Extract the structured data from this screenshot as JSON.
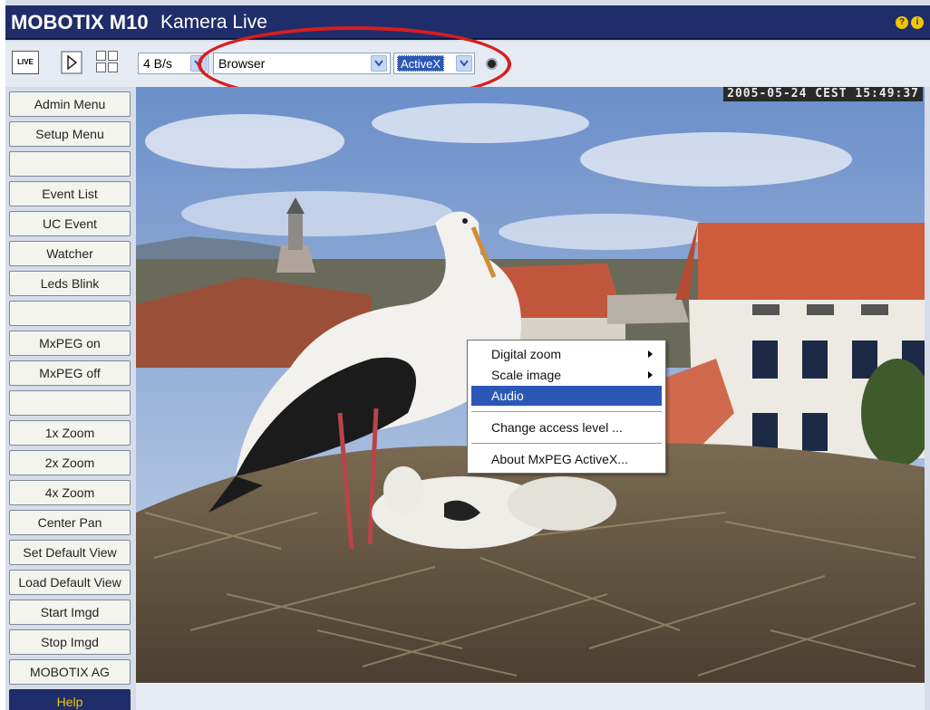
{
  "title": {
    "brand": "MOBOTIX M10",
    "subtitle": "Kamera Live",
    "help_icons": [
      "?",
      "i"
    ]
  },
  "toolbar": {
    "live_label": "LIVE",
    "play_icon": "play-icon",
    "grid_icon": "grid-icon",
    "rate_value": "4 B/s",
    "view_value": "Browser",
    "mode_value": "ActiveX"
  },
  "sidebar": {
    "items": [
      "Admin Menu",
      "Setup Menu",
      "",
      "Event List",
      "UC Event",
      "Watcher",
      "Leds Blink",
      "",
      "MxPEG on",
      "MxPEG off",
      "",
      "1x Zoom",
      "2x Zoom",
      "4x Zoom",
      "Center Pan",
      "Set Default View",
      "Load Default View",
      "Start Imgd",
      "Stop Imgd",
      "MOBOTIX AG",
      "Help"
    ]
  },
  "camera": {
    "timestamp": "2005-05-24 CEST 15:49:37"
  },
  "context_menu": {
    "items": [
      {
        "label": "Digital zoom",
        "submenu": true
      },
      {
        "label": "Scale image",
        "submenu": true
      },
      {
        "label": "Audio",
        "selected": true
      },
      {
        "label": "Change access level ..."
      },
      {
        "label": "About MxPEG ActiveX..."
      }
    ]
  },
  "colors": {
    "titlebar": "#1f2d6a",
    "accent_yellow": "#f2c500",
    "highlight": "#2b58b5",
    "annotation": "#d81e1e"
  }
}
